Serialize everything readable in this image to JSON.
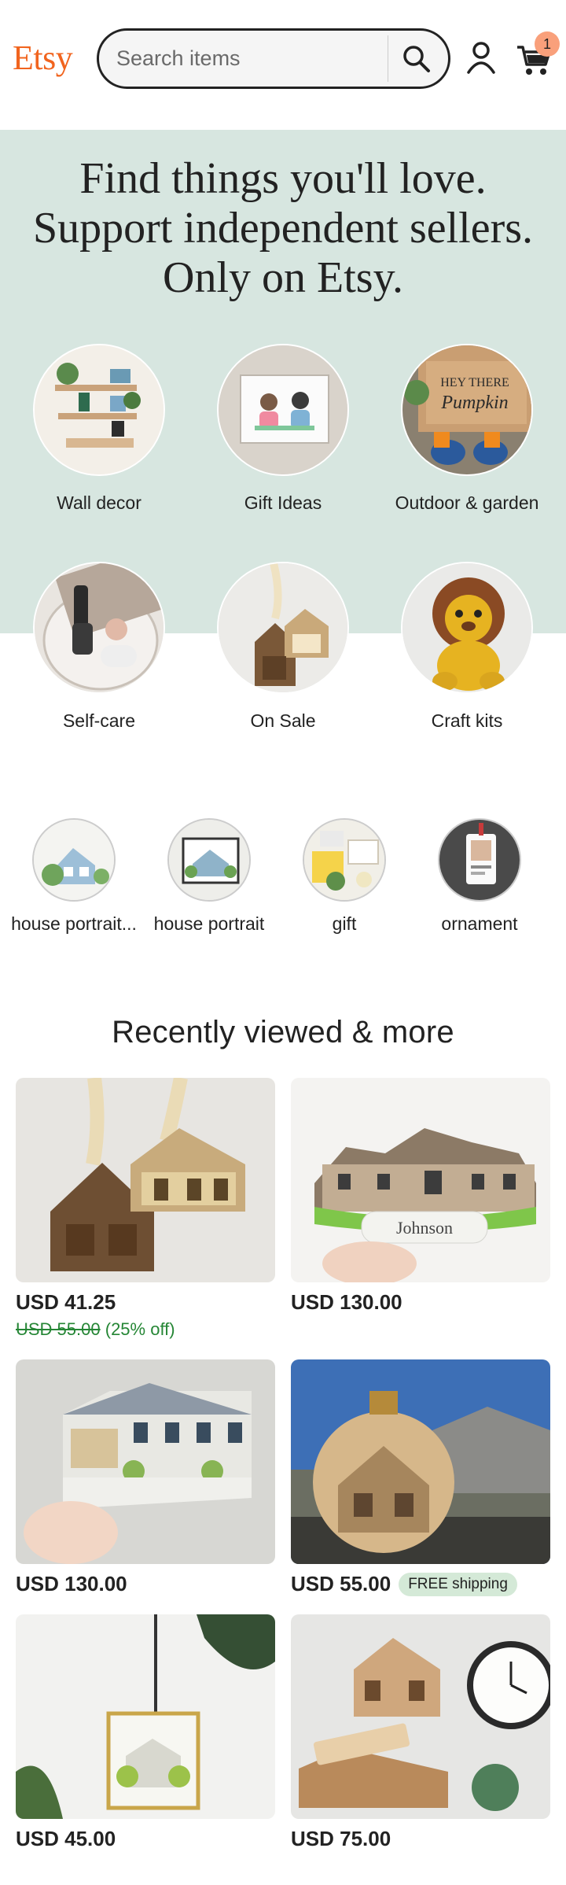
{
  "header": {
    "logo": "Etsy",
    "search_placeholder": "Search items",
    "cart_count": "1"
  },
  "hero": {
    "title_lines": [
      "Find things you'll love.",
      "Support independent sellers.",
      "Only on Etsy."
    ],
    "categories": [
      {
        "label": "Wall decor",
        "icon": "wall-decor-photo"
      },
      {
        "label": "Gift Ideas",
        "icon": "gift-ideas-photo"
      },
      {
        "label": "Outdoor & garden",
        "icon": "outdoor-garden-photo"
      },
      {
        "label": "Self-care",
        "icon": "self-care-photo"
      },
      {
        "label": "On Sale",
        "icon": "on-sale-photo"
      },
      {
        "label": "Craft kits",
        "icon": "craft-kits-photo"
      }
    ]
  },
  "popular_searches": [
    {
      "label": "house portrait..."
    },
    {
      "label": "house portrait"
    },
    {
      "label": "gift"
    },
    {
      "label": "ornament"
    }
  ],
  "recently_viewed": {
    "title": "Recently viewed & more",
    "items": [
      {
        "price": "USD 41.25",
        "original_price": "USD 55.00",
        "discount": "(25% off)"
      },
      {
        "price": "USD 130.00"
      },
      {
        "price": "USD 130.00"
      },
      {
        "price": "USD 55.00",
        "badge": "FREE shipping"
      },
      {
        "price": "USD 45.00"
      },
      {
        "price": "USD 75.00"
      }
    ]
  },
  "colors": {
    "brand": "#f1641e",
    "hero_bg": "#d7e6e0",
    "sale_green": "#258635",
    "badge_green": "#d4e9d7"
  }
}
